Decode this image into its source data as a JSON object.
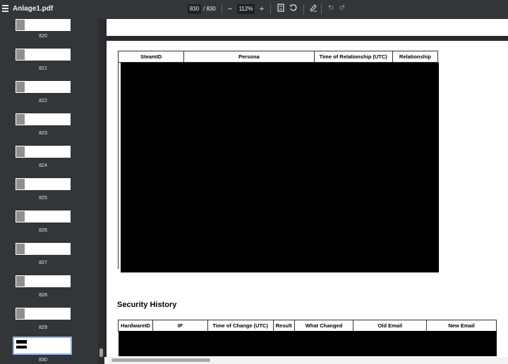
{
  "toolbar": {
    "file_name": "Anlage1.pdf",
    "current_page": "830",
    "page_total": "/ 830",
    "zoom": "112%",
    "zoom_out_symbol": "−",
    "zoom_in_symbol": "+",
    "icons": [
      "menu-icon",
      "zoom-out-icon",
      "zoom-in-icon",
      "fit-page-icon",
      "rotate-icon",
      "annotate-icon",
      "undo-icon",
      "redo-icon"
    ]
  },
  "sidebar": {
    "thumbnails": [
      {
        "label": "820"
      },
      {
        "label": "821"
      },
      {
        "label": "822"
      },
      {
        "label": "823"
      },
      {
        "label": "824"
      },
      {
        "label": "825"
      },
      {
        "label": "826"
      },
      {
        "label": "827"
      },
      {
        "label": "828"
      },
      {
        "label": "829"
      },
      {
        "label": "830"
      }
    ],
    "selected": "830",
    "selection_color": "#8ab4f8"
  },
  "document": {
    "relationship_table": {
      "headers": [
        "SteamID",
        "Persona",
        "Time of Relationship (UTC)",
        "Relationship"
      ],
      "rows_redacted": true
    },
    "security_history": {
      "heading": "Security History",
      "headers": [
        "HardwareID",
        "IP",
        "Time of Change (UTC)",
        "Result",
        "What Changed",
        "Old Email",
        "New Email"
      ],
      "rows_redacted": true
    }
  }
}
